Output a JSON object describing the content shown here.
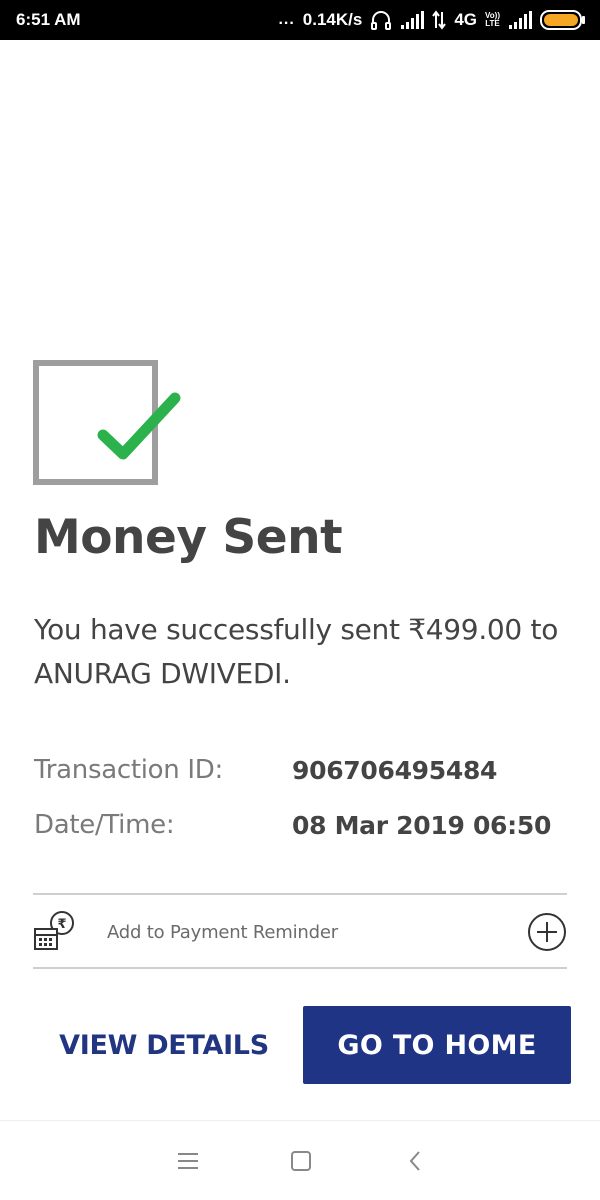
{
  "status_bar": {
    "time": "6:51 AM",
    "dots": "...",
    "network_speed": "0.14K/s",
    "network_type": "4G",
    "volte_line1": "Vo))",
    "volte_line2": "LTE",
    "icons": [
      "headset-icon",
      "signal-icon",
      "data-arrows-icon",
      "volte-icon",
      "signal-icon",
      "battery-icon"
    ],
    "battery_color": "#f5a623"
  },
  "success": {
    "icon": "checkbox-checked-icon",
    "check_color": "#2bb24c",
    "box_color": "#9e9e9e",
    "title": "Money Sent",
    "message": "You have successfully sent ₹499.00 to ANURAG DWIVEDI."
  },
  "details": {
    "transaction_label": "Transaction ID:",
    "transaction_value": "906706495484",
    "datetime_label": "Date/Time:",
    "datetime_value": "08 Mar 2019 06:50"
  },
  "reminder": {
    "icon": "calendar-rupee-icon",
    "label": "Add to Payment Reminder",
    "action_icon": "plus-circle-icon"
  },
  "actions": {
    "view_details": "VIEW DETAILS",
    "go_home": "GO TO HOME",
    "primary_color": "#1f3484"
  },
  "nav": {
    "icons": [
      "menu-icon",
      "home-square-icon",
      "back-icon"
    ]
  }
}
